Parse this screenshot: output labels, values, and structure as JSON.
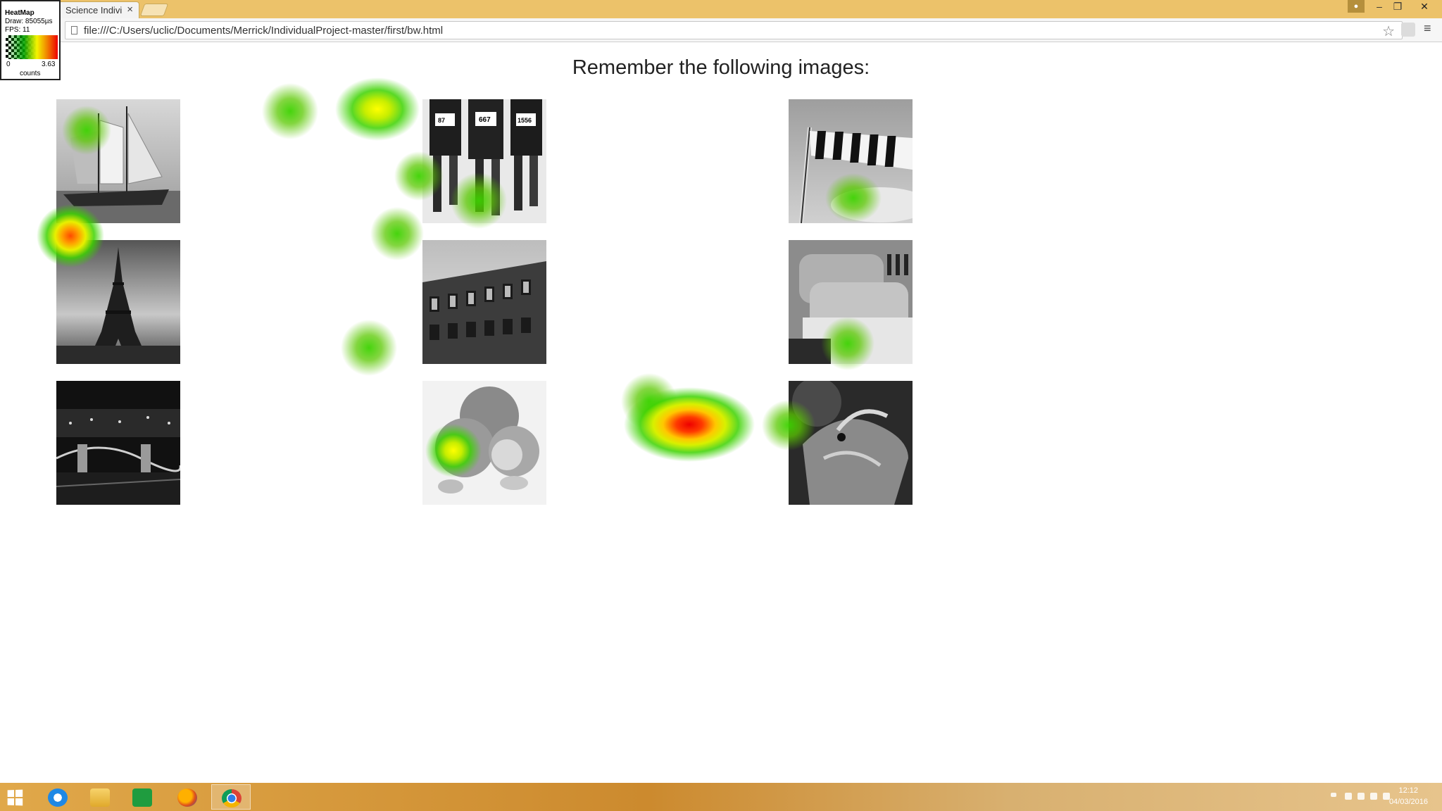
{
  "browser": {
    "tab_title": "Science Individual",
    "tab_close": "×",
    "url": "file:///C:/Users/uclic/Documents/Merrick/IndividualProject-master/first/bw.html",
    "menu_glyph": "≡",
    "star_glyph": "☆"
  },
  "window_controls": {
    "minimize": "–",
    "maximize": "❐",
    "close": "✕"
  },
  "heatmap_legend": {
    "title": "HeatMap",
    "draw": "Draw: 85055µs",
    "fps": "FPS: 11",
    "min": "0",
    "max": "3.63",
    "unit": "counts",
    "colors": [
      "#000000",
      "#00a000",
      "#f4f400",
      "#f08000",
      "#ee0000"
    ]
  },
  "page": {
    "heading": "Remember the following images:",
    "images": [
      {
        "id": "sailing-ship",
        "subject": "tall sailing ship"
      },
      {
        "id": "marathon-runners",
        "subject": "marathon runners with race bibs"
      },
      {
        "id": "windsock",
        "subject": "striped windsock"
      },
      {
        "id": "eiffel-tower",
        "subject": "Eiffel Tower"
      },
      {
        "id": "brick-building",
        "subject": "gothic brick building"
      },
      {
        "id": "toast",
        "subject": "toast in toaster"
      },
      {
        "id": "chain-bridge",
        "subject": "chain bridge at night"
      },
      {
        "id": "mandarins",
        "subject": "mandarin oranges"
      },
      {
        "id": "dragon-statue",
        "subject": "dragon statue"
      }
    ],
    "bib_numbers": [
      "87",
      "667",
      "1556"
    ]
  },
  "heatmap_intensity_levels": [
    "green",
    "yellow",
    "orange",
    "red"
  ],
  "taskbar": {
    "apps": [
      "start",
      "internet-explorer",
      "file-explorer",
      "store",
      "firefox",
      "chrome"
    ],
    "active_app": "chrome",
    "time": "12:12",
    "date": "04/03/2016"
  }
}
